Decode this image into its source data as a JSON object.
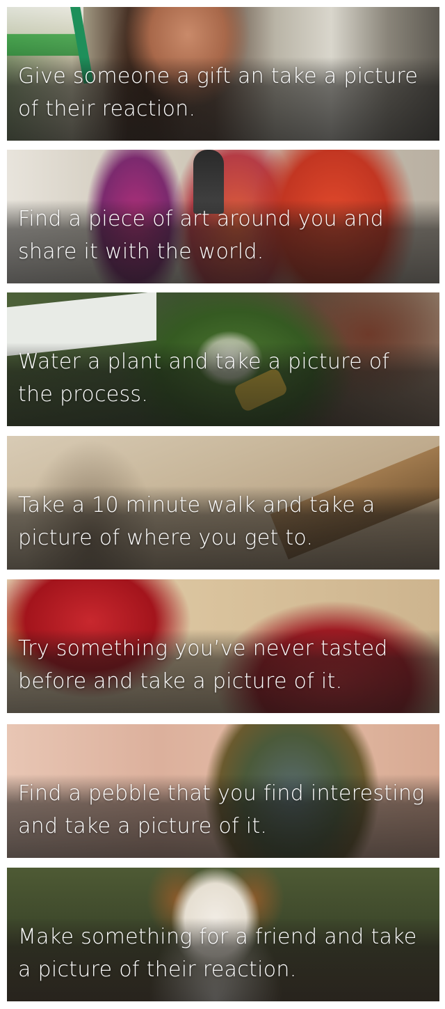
{
  "cards": [
    {
      "caption": "Give someone a gift an take a picture of their reaction."
    },
    {
      "caption": "Find a piece of art around you and share it with the world."
    },
    {
      "caption": "Water a plant and take a picture of the process."
    },
    {
      "caption": "Take a 10 minute walk and take a picture of where you get to."
    },
    {
      "caption": "Try something you’ve never tasted before and take a picture of it."
    },
    {
      "caption": "Find a pebble that you find interesting and take a picture of it."
    },
    {
      "caption": "Make something for a friend and take a picture of their reaction."
    }
  ]
}
